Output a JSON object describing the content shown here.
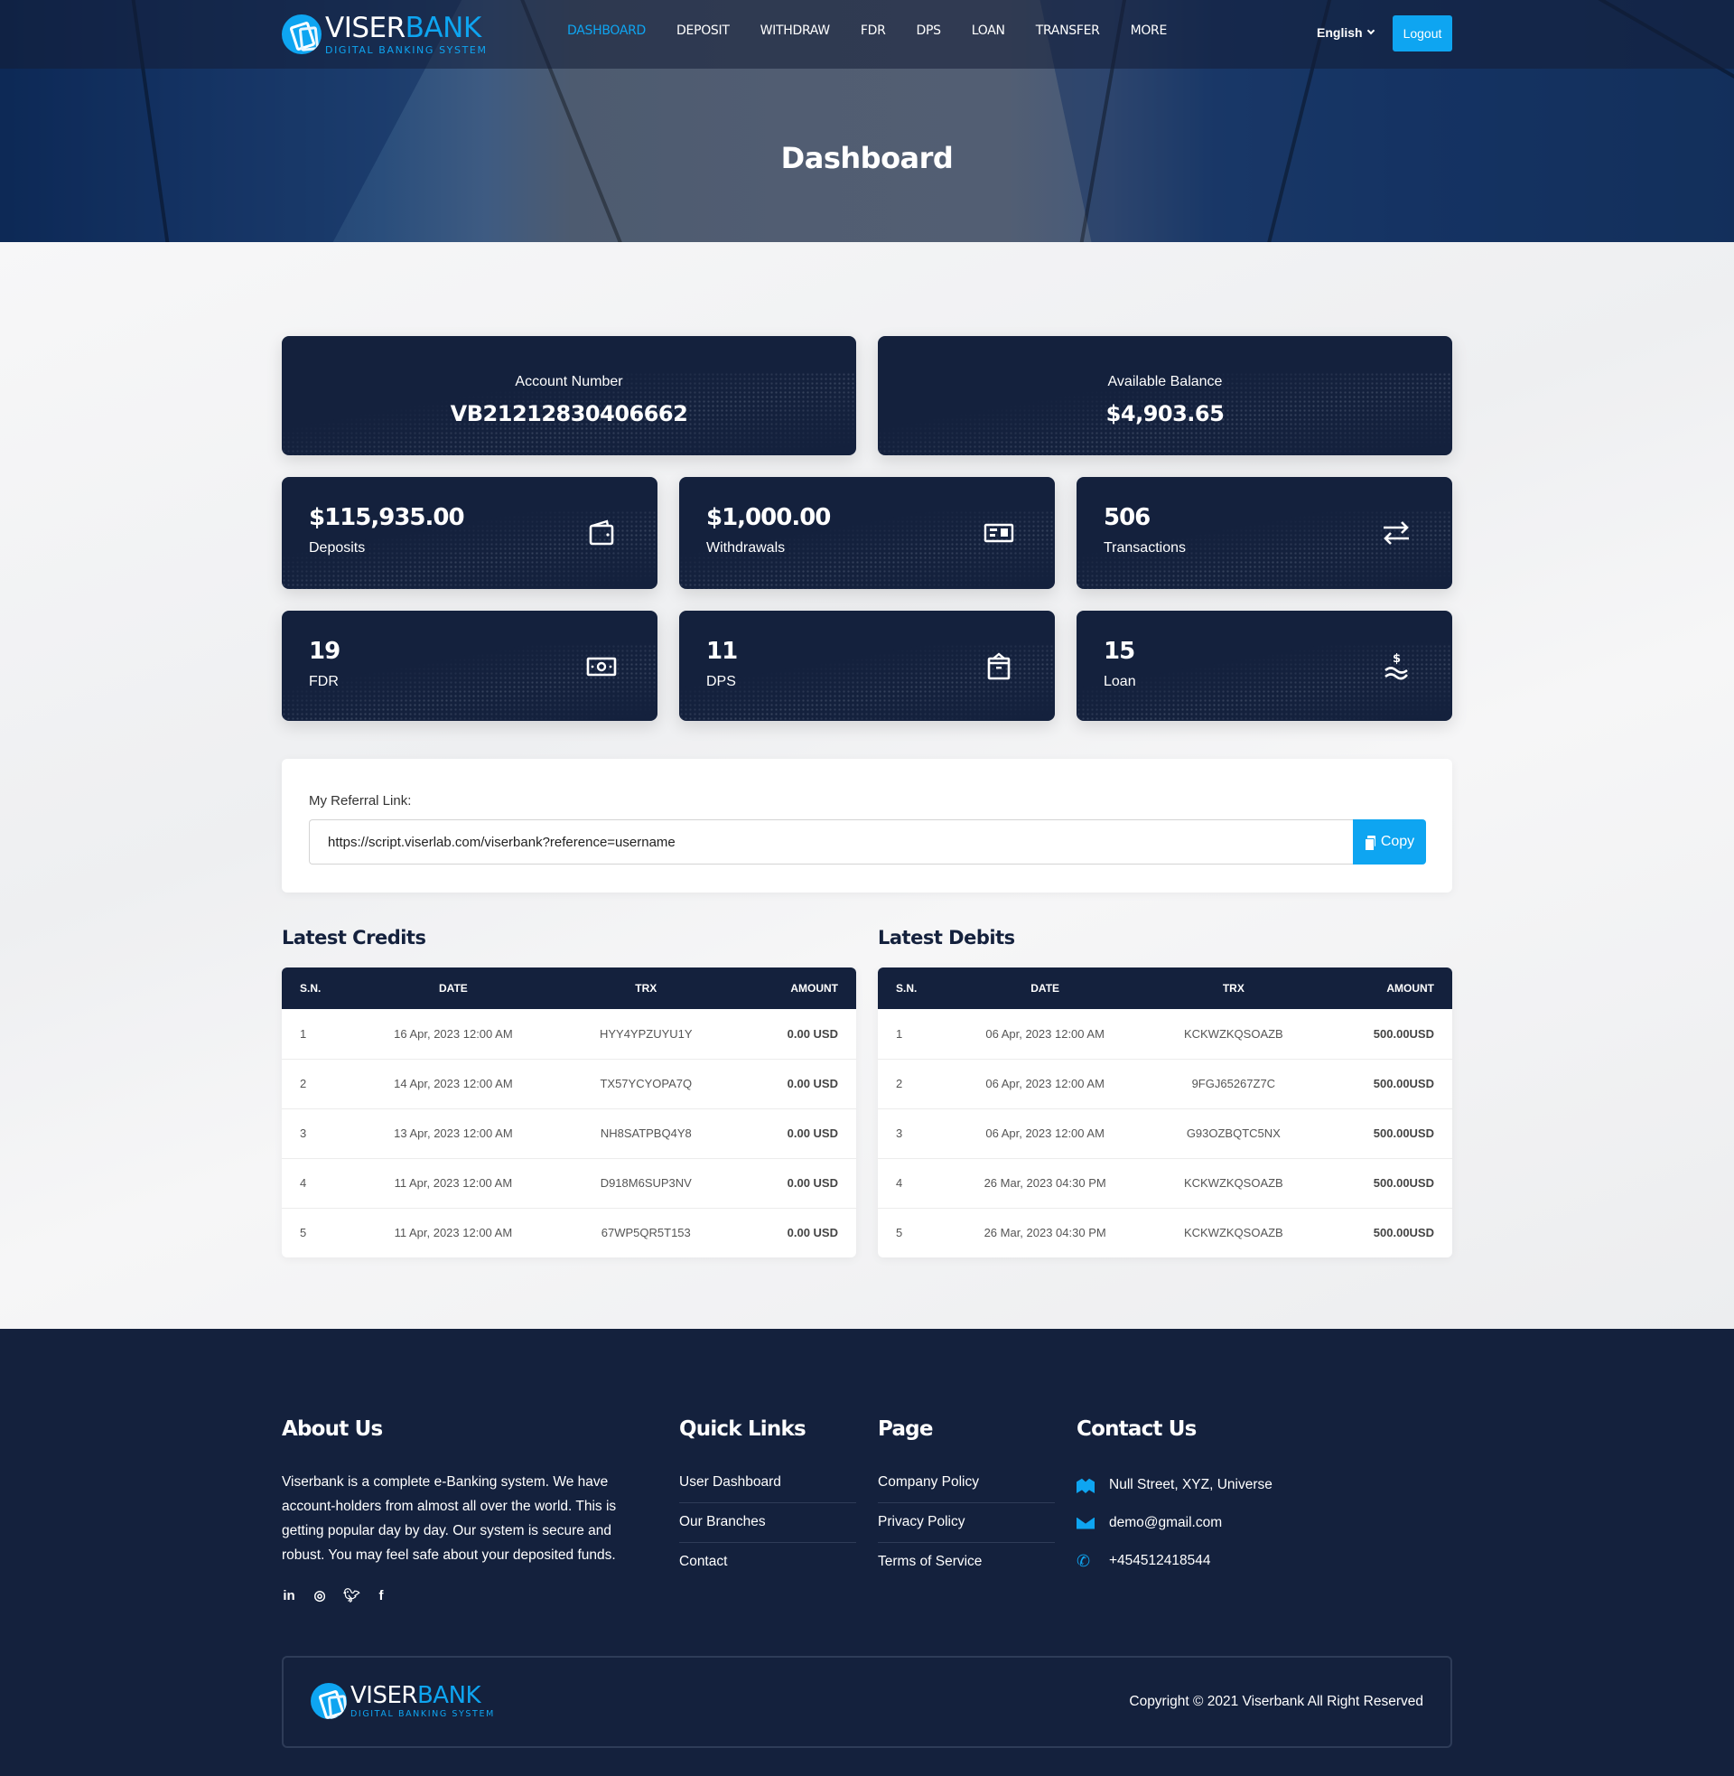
{
  "brand": {
    "name_part1": "VISER",
    "name_part2": "BANK",
    "tagline": "DIGITAL BANKING SYSTEM",
    "accent": "#0ea5f1",
    "dark": "#14213d"
  },
  "nav": {
    "items": [
      {
        "label": "DASHBOARD",
        "active": true
      },
      {
        "label": "DEPOSIT"
      },
      {
        "label": "WITHDRAW"
      },
      {
        "label": "FDR"
      },
      {
        "label": "DPS"
      },
      {
        "label": "LOAN"
      },
      {
        "label": "TRANSFER"
      },
      {
        "label": "MORE"
      }
    ],
    "language": "English",
    "logout_label": "Logout"
  },
  "hero": {
    "title": "Dashboard"
  },
  "account": {
    "number_label": "Account Number",
    "number": "VB21212830406662",
    "balance_label": "Available Balance",
    "balance": "$4,903.65"
  },
  "stats": [
    {
      "value": "$115,935.00",
      "label": "Deposits",
      "icon": "wallet-icon"
    },
    {
      "value": "$1,000.00",
      "label": "Withdrawals",
      "icon": "money-check-icon"
    },
    {
      "value": "506",
      "label": "Transactions",
      "icon": "exchange-arrows-icon"
    },
    {
      "value": "19",
      "label": "FDR",
      "icon": "money-bill-icon"
    },
    {
      "value": "11",
      "label": "DPS",
      "icon": "archive-box-icon"
    },
    {
      "value": "15",
      "label": "Loan",
      "icon": "hand-holding-dollar-icon"
    }
  ],
  "referral": {
    "label": "My Referral Link:",
    "link": "https://script.viserlab.com/viserbank?reference=username",
    "copy_label": "Copy"
  },
  "credits": {
    "title": "Latest Credits",
    "columns": [
      "S.N.",
      "DATE",
      "TRX",
      "AMOUNT"
    ],
    "rows": [
      {
        "sn": "1",
        "date": "16 Apr, 2023 12:00 AM",
        "trx": "HYY4YPZUYU1Y",
        "amount": "0.00 USD"
      },
      {
        "sn": "2",
        "date": "14 Apr, 2023 12:00 AM",
        "trx": "TX57YCYOPA7Q",
        "amount": "0.00 USD"
      },
      {
        "sn": "3",
        "date": "13 Apr, 2023 12:00 AM",
        "trx": "NH8SATPBQ4Y8",
        "amount": "0.00 USD"
      },
      {
        "sn": "4",
        "date": "11 Apr, 2023 12:00 AM",
        "trx": "D918M6SUP3NV",
        "amount": "0.00 USD"
      },
      {
        "sn": "5",
        "date": "11 Apr, 2023 12:00 AM",
        "trx": "67WP5QR5T153",
        "amount": "0.00 USD"
      }
    ]
  },
  "debits": {
    "title": "Latest Debits",
    "columns": [
      "S.N.",
      "DATE",
      "TRX",
      "AMOUNT"
    ],
    "rows": [
      {
        "sn": "1",
        "date": "06 Apr, 2023 12:00 AM",
        "trx": "KCKWZKQSOAZB",
        "amount": "500.00USD"
      },
      {
        "sn": "2",
        "date": "06 Apr, 2023 12:00 AM",
        "trx": "9FGJ65267Z7C",
        "amount": "500.00USD"
      },
      {
        "sn": "3",
        "date": "06 Apr, 2023 12:00 AM",
        "trx": "G93OZBQTC5NX",
        "amount": "500.00USD"
      },
      {
        "sn": "4",
        "date": "26 Mar, 2023 04:30 PM",
        "trx": "KCKWZKQSOAZB",
        "amount": "500.00USD"
      },
      {
        "sn": "5",
        "date": "26 Mar, 2023 04:30 PM",
        "trx": "KCKWZKQSOAZB",
        "amount": "500.00USD"
      }
    ]
  },
  "footer": {
    "about": {
      "title": "About Us",
      "text": "Viserbank is a complete e-Banking system. We have account-holders from almost all over the world. This is getting popular day by day. Our system is secure and robust. You may feel safe about your deposited funds.",
      "social": [
        {
          "name": "linkedin-icon",
          "glyph": "in"
        },
        {
          "name": "instagram-icon",
          "glyph": "◎"
        },
        {
          "name": "twitter-icon",
          "glyph": "🐦︎"
        },
        {
          "name": "facebook-icon",
          "glyph": "f"
        }
      ]
    },
    "quick_links": {
      "title": "Quick Links",
      "items": [
        "User Dashboard",
        "Our Branches",
        "Contact"
      ]
    },
    "page": {
      "title": "Page",
      "items": [
        "Company Policy",
        "Privacy Policy",
        "Terms of Service"
      ]
    },
    "contact": {
      "title": "Contact Us",
      "address": "Null Street, XYZ, Universe",
      "email": "demo@gmail.com",
      "phone": "+454512418544"
    },
    "copyright": "Copyright © 2021 Viserbank All Right Reserved"
  }
}
